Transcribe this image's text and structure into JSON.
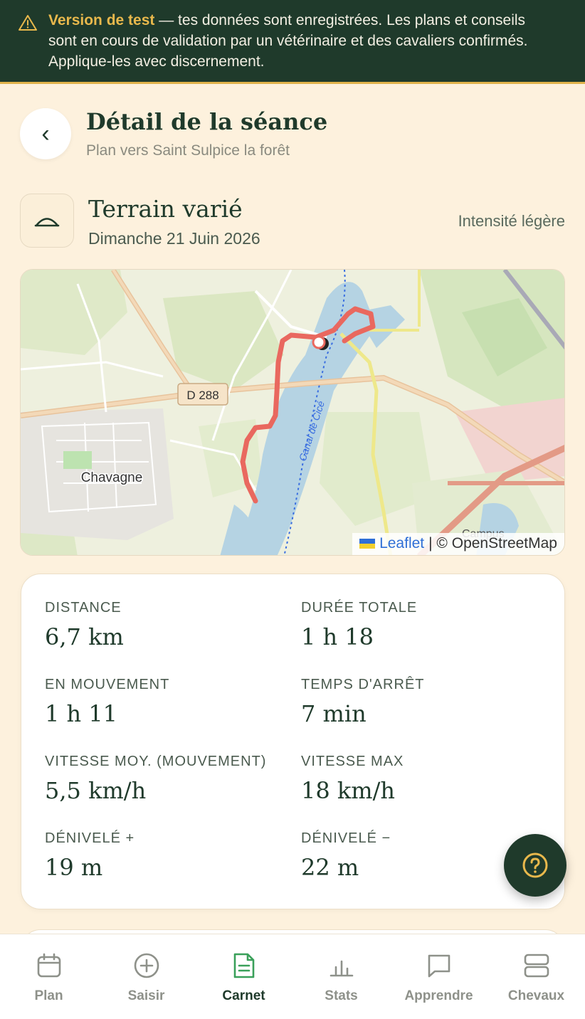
{
  "banner": {
    "strong": "Version de test",
    "text": " — tes données sont enregistrées. Les plans et conseils sont en cours de validation par un vétérinaire et des cavaliers confirmés. Applique-les avec discernement."
  },
  "header": {
    "title": "Détail de la séance",
    "subtitle": "Plan vers Saint Sulpice la forêt"
  },
  "session": {
    "type": "Terrain varié",
    "date": "Dimanche 21 Juin 2026",
    "intensity": "Intensité légère"
  },
  "map": {
    "road_label": "D 288",
    "town_label": "Chavagne",
    "canal_label": "Canal de Cicé",
    "campus_label": "Campus",
    "attribution_leaflet": "Leaflet",
    "attribution_osm": "| © OpenStreetMap",
    "route_color": "#e9685f"
  },
  "stats": [
    {
      "label": "DISTANCE",
      "value": "6,7 km"
    },
    {
      "label": "DURÉE TOTALE",
      "value": "1 h 18"
    },
    {
      "label": "EN MOUVEMENT",
      "value": "1 h 11"
    },
    {
      "label": "TEMPS D'ARRÊT",
      "value": "7 min"
    },
    {
      "label": "VITESSE MOY. (MOUVEMENT)",
      "value": "5,5 km/h"
    },
    {
      "label": "VITESSE MAX",
      "value": "18 km/h"
    },
    {
      "label": "DÉNIVELÉ +",
      "value": "19 m"
    },
    {
      "label": "DÉNIVELÉ −",
      "value": "22 m"
    }
  ],
  "tabs": [
    {
      "label": "Plan",
      "icon": "calendar-icon"
    },
    {
      "label": "Saisir",
      "icon": "plus-circle-icon"
    },
    {
      "label": "Carnet",
      "icon": "document-icon",
      "active": true
    },
    {
      "label": "Stats",
      "icon": "bar-chart-icon"
    },
    {
      "label": "Apprendre",
      "icon": "chat-icon"
    },
    {
      "label": "Chevaux",
      "icon": "stack-icon"
    }
  ],
  "colors": {
    "brand_dark": "#1f3a2b",
    "accent_gold": "#e8b84c",
    "background": "#fdf1dd"
  }
}
